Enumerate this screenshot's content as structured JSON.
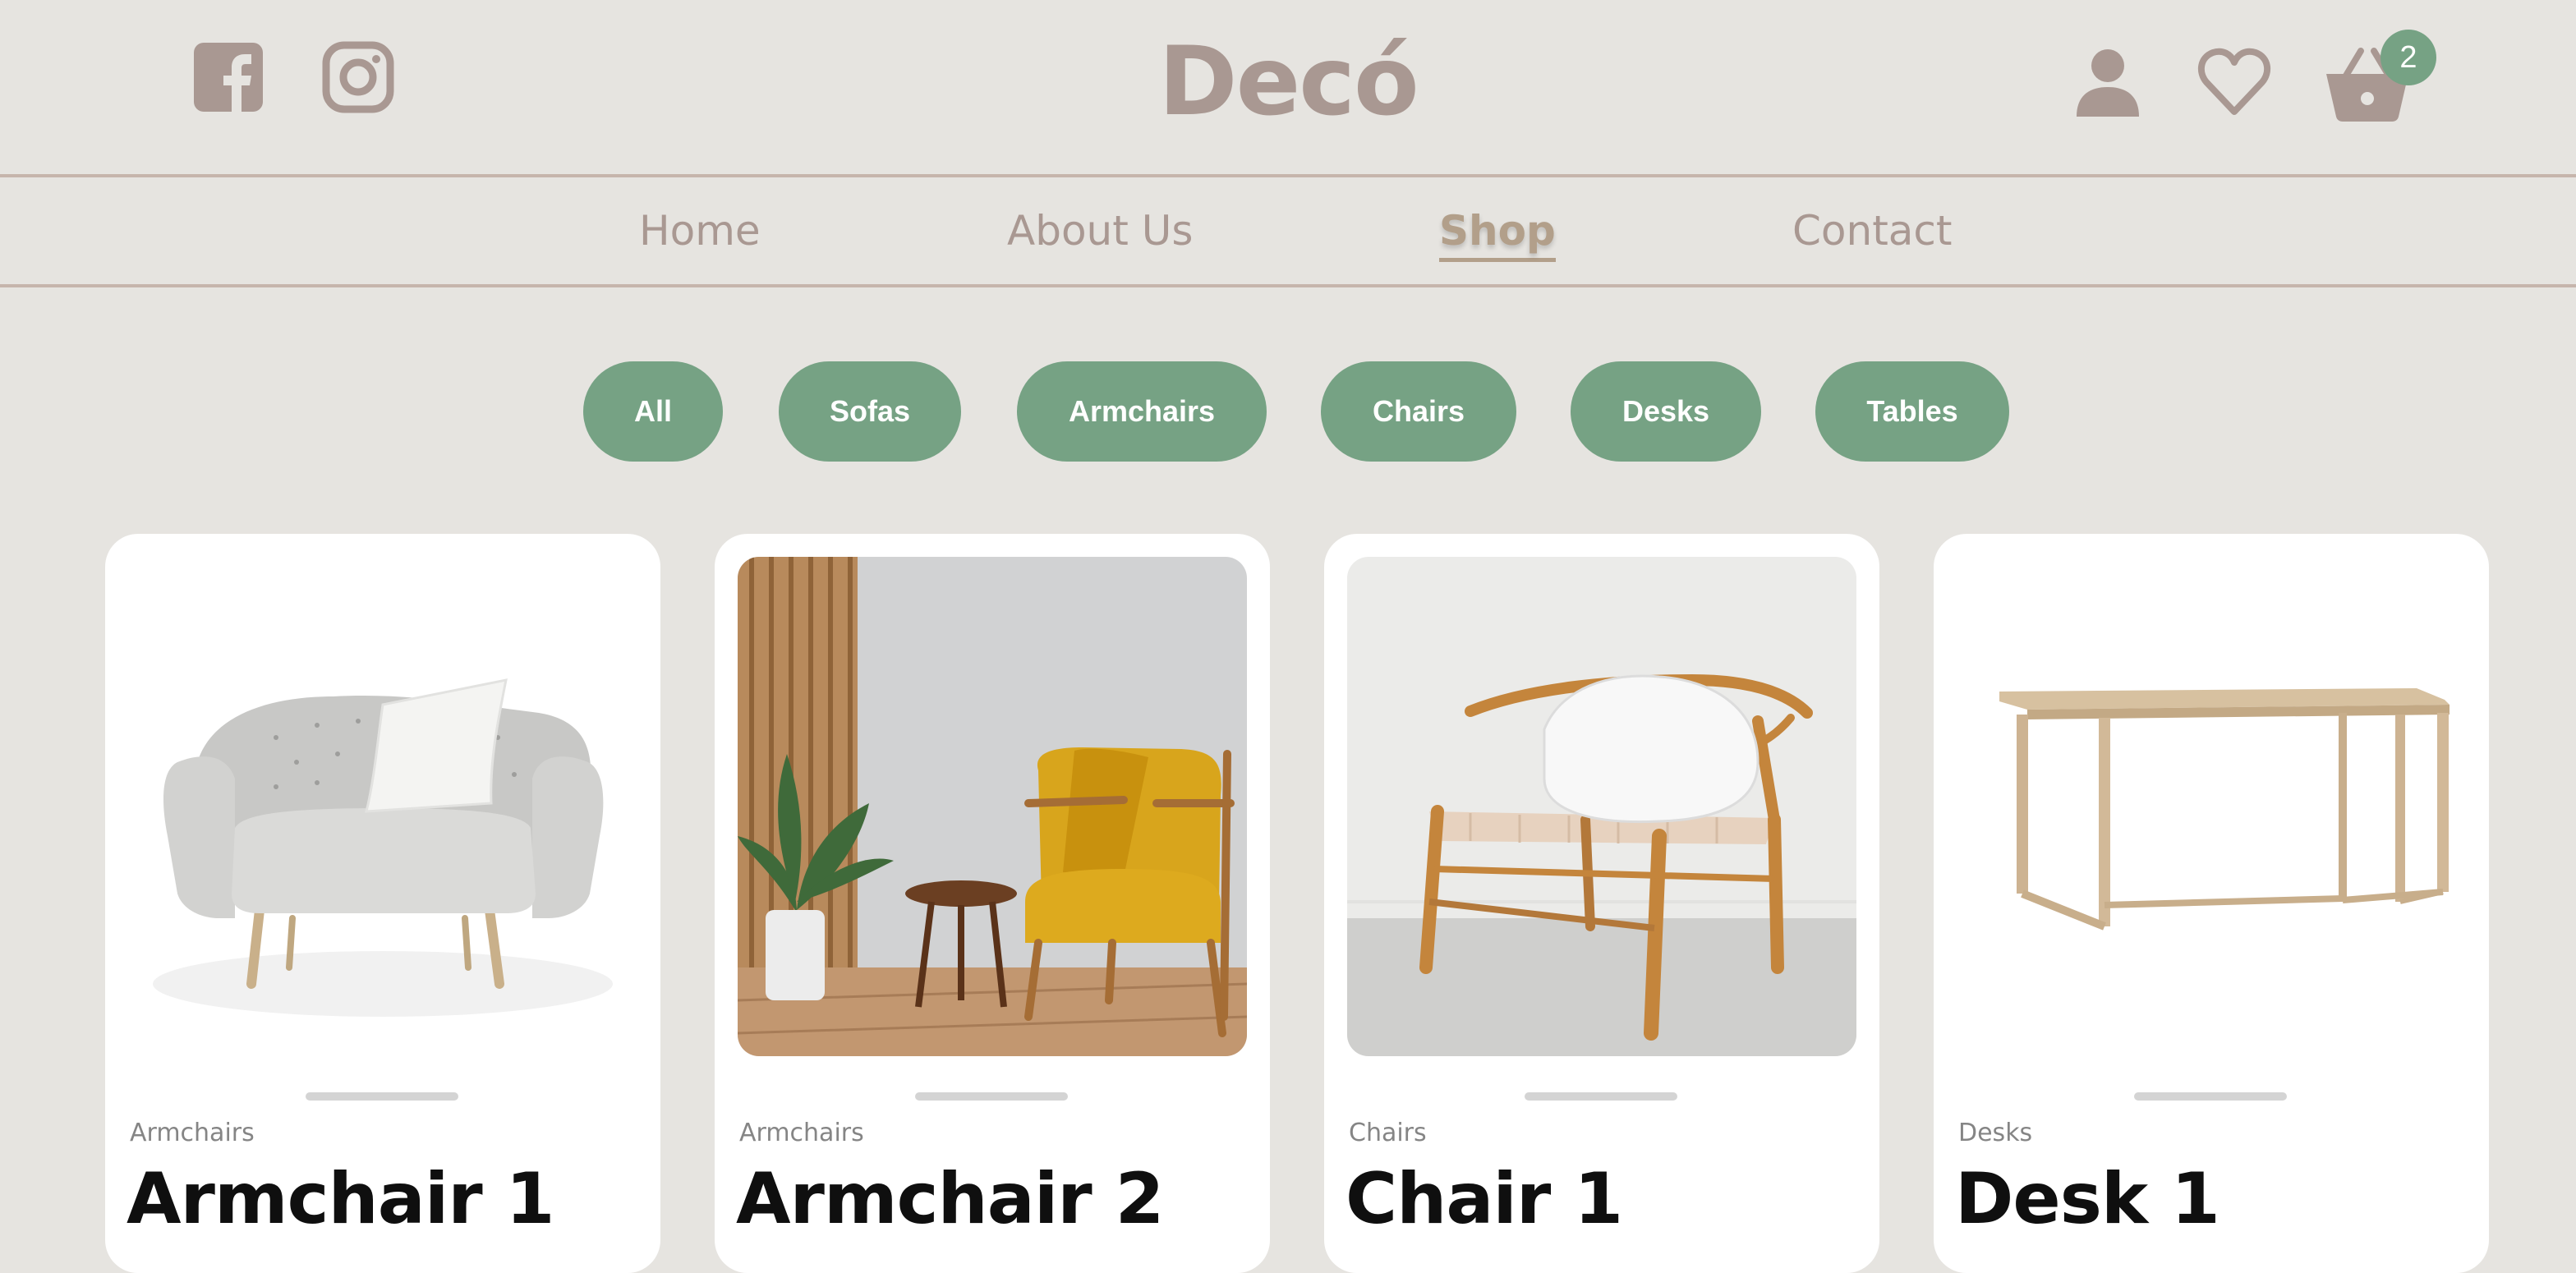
{
  "brand": {
    "logo_text": "Decó",
    "accent": "#76a284",
    "muted": "#a99892",
    "background": "#e6e4e0"
  },
  "header": {
    "social": [
      "facebook-icon",
      "instagram-icon"
    ],
    "actions": [
      "user-icon",
      "heart-icon",
      "basket-icon"
    ],
    "cart_count": "2"
  },
  "nav": {
    "items": [
      {
        "label": "Home"
      },
      {
        "label": "About Us"
      },
      {
        "label": "Shop"
      },
      {
        "label": "Contact"
      }
    ],
    "active": "Shop"
  },
  "filters": {
    "items": [
      {
        "label": "All"
      },
      {
        "label": "Sofas"
      },
      {
        "label": "Armchairs"
      },
      {
        "label": "Chairs"
      },
      {
        "label": "Desks"
      },
      {
        "label": "Tables"
      }
    ]
  },
  "products": [
    {
      "category": "Armchairs",
      "name": "Armchair 1"
    },
    {
      "category": "Armchairs",
      "name": "Armchair 2"
    },
    {
      "category": "Chairs",
      "name": "Chair 1"
    },
    {
      "category": "Desks",
      "name": "Desk 1"
    }
  ]
}
